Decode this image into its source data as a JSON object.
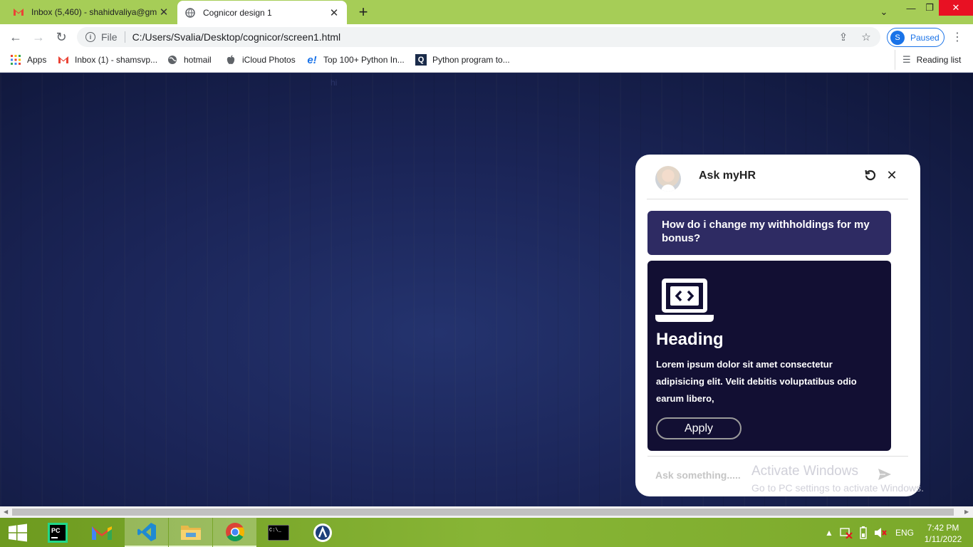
{
  "browser": {
    "tabs": [
      {
        "title": "Inbox (5,460) - shahidvaliya@gm",
        "icon": "gmail-icon"
      },
      {
        "title": "Cognicor design 1",
        "icon": "globe-icon"
      }
    ],
    "omnibox": {
      "scheme_label": "File",
      "url": "C:/Users/Svalia/Desktop/cognicor/screen1.html"
    },
    "profile": {
      "initial": "S",
      "label": "Paused"
    },
    "bookmarks": [
      {
        "label": "Apps"
      },
      {
        "label": "Inbox (1) - shamsvp..."
      },
      {
        "label": "hotmail"
      },
      {
        "label": "iCloud Photos"
      },
      {
        "label": "Top 100+ Python In..."
      },
      {
        "label": "Python program to..."
      }
    ],
    "reading_list": "Reading list"
  },
  "page": {
    "hint_text": "hi"
  },
  "chat": {
    "title": "Ask myHR",
    "user_message": "How do i change my withholdings for my bonus?",
    "card": {
      "heading": "Heading",
      "text": "Lorem ipsum dolor sit amet consectetur adipisicing elit. Velit debitis voluptatibus odio earum libero,",
      "button": "Apply"
    },
    "input_placeholder": "Ask something....."
  },
  "watermark": {
    "line1": "Activate Windows",
    "line2": "Go to PC settings to activate Windows."
  },
  "taskbar": {
    "language": "ENG",
    "time": "7:42 PM",
    "date": "1/11/2022"
  },
  "colors": {
    "tab_strip": "#a6cd57",
    "user_bubble": "#2e2b63",
    "bot_card": "#120f33",
    "page_bg": "#1a2454"
  }
}
